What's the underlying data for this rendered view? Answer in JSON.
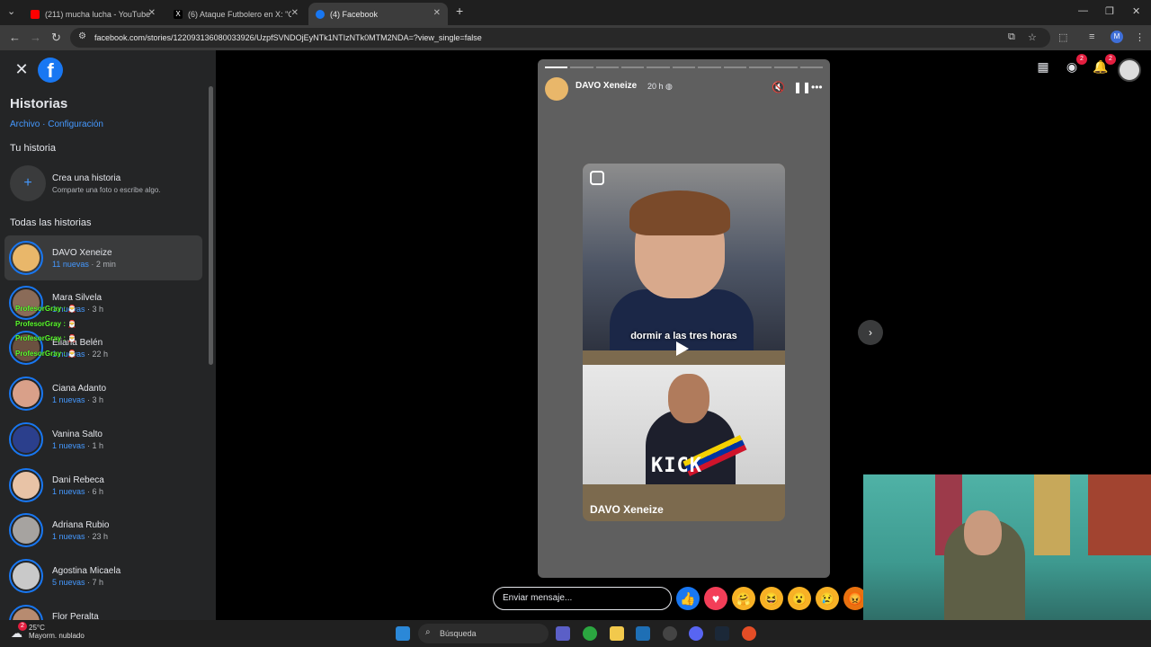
{
  "browser": {
    "tabs": [
      {
        "label": "(211) mucha lucha - YouTube",
        "fav_color": "#ff0000"
      },
      {
        "label": "(6) Ataque Futbolero en X: \"Cor",
        "fav_color": "#000000"
      },
      {
        "label": "(4) Facebook",
        "fav_color": "#1877f2"
      }
    ],
    "url": "facebook.com/stories/122093136080033926/UzpfSVNDOjEyNTk1NTIzNTk0MTM2NDA=?view_single=false",
    "profile_initial": "M"
  },
  "sidebar": {
    "title": "Historias",
    "links": "Archivo · Configuración",
    "your_story_heading": "Tu historia",
    "create_title": "Crea una historia",
    "create_sub": "Comparte una foto o escribe algo.",
    "all_heading": "Todas las historias",
    "stories": [
      {
        "name": "DAVO Xeneize",
        "count": "11 nuevas",
        "time": "· 2 min",
        "color": "#e9b76a"
      },
      {
        "name": "Mara Silvela",
        "count": "1 nuevas",
        "time": "· 3 h",
        "color": "#8a6b58"
      },
      {
        "name": "Eliana Belén",
        "count": "1 nuevas",
        "time": "· 22 h",
        "color": "#6b5140"
      },
      {
        "name": "Ciana Adanto",
        "count": "1 nuevas",
        "time": "· 3 h",
        "color": "#d9a089"
      },
      {
        "name": "Vanina Salto",
        "count": "1 nuevas",
        "time": "· 1 h",
        "color": "#2b3f8c"
      },
      {
        "name": "Dani Rebeca",
        "count": "1 nuevas",
        "time": "· 6 h",
        "color": "#e8c3a6"
      },
      {
        "name": "Adriana Rubio",
        "count": "1 nuevas",
        "time": "· 23 h",
        "color": "#a6a3a0"
      },
      {
        "name": "Agostina Micaela",
        "count": "5 nuevas",
        "time": "· 7 h",
        "color": "#c9c9c9"
      },
      {
        "name": "Flor Peralta",
        "count": "",
        "time": "",
        "color": "#b78b70"
      }
    ],
    "chat_overlay": [
      "ProfesorGray : 🎅",
      "ProfesorGray : 🎅",
      "ProfesorGray : 🎅",
      "ProfesorGray : 🎅"
    ]
  },
  "story": {
    "author": "DAVO Xeneize",
    "time": "20 h",
    "caption": "dormir a las tres horas",
    "overlay_text": "KICK",
    "reel_author": "DAVO Xeneize",
    "segments_total": 11,
    "segments_active": 1
  },
  "topbar": {
    "messenger_badge": "2",
    "notif_badge": "2"
  },
  "reply": {
    "placeholder": "Enviar mensaje...",
    "reactions": [
      {
        "name": "like",
        "glyph": "👍",
        "color": "#1877f2"
      },
      {
        "name": "love",
        "glyph": "♥",
        "color": "#f33e58"
      },
      {
        "name": "care",
        "glyph": "🤗",
        "color": "#f7b125"
      },
      {
        "name": "haha",
        "glyph": "😆",
        "color": "#f7b125"
      },
      {
        "name": "wow",
        "glyph": "😮",
        "color": "#f7b125"
      },
      {
        "name": "sad",
        "glyph": "😢",
        "color": "#f7b125"
      },
      {
        "name": "angry",
        "glyph": "😡",
        "color": "#e9710f"
      }
    ]
  },
  "taskbar": {
    "temp": "25°C",
    "weather": "Mayorm. nublado",
    "search_placeholder": "Búsqueda",
    "weather_badge": "2"
  }
}
